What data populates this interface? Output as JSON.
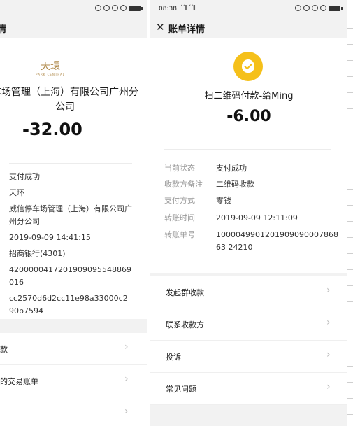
{
  "left": {
    "nav_title_fragment": "情",
    "brand_name": "天環",
    "brand_sub": "PARK CENTRAL",
    "merchant_name": "车场管理（上海）有限公司广州分公司",
    "amount": "-32.00",
    "info": [
      "支付成功",
      "天环",
      "威信停车场管理（上海）有限公司广州分公司",
      "2019-09-09 14:41:15",
      "招商银行(4301)",
      "4200000417201909095548869016",
      "cc2570d6d2cc11e98a33000c290b7594"
    ],
    "actions": [
      "款",
      "的交易账单",
      ""
    ]
  },
  "right": {
    "status_time": "08:38",
    "status_signal": "´´il ´´il",
    "nav_title": "账单详情",
    "pay_title": "扫二维码付款-给Ming",
    "amount": "-6.00",
    "details": [
      {
        "key": "当前状态",
        "value": "支付成功"
      },
      {
        "key": "收款方备注",
        "value": "二维码收款"
      },
      {
        "key": "支付方式",
        "value": "零钱"
      },
      {
        "key": "转账时间",
        "value": "2019-09-09 12:11:09"
      },
      {
        "key": "转账单号",
        "value": "100004990120190909000786863 24210"
      }
    ],
    "actions": [
      "发起群收款",
      "联系收款方",
      "投诉",
      "常见问题"
    ]
  },
  "icons": {
    "close": "close-icon",
    "chevron": "chevron-right-icon",
    "coin": "money-bag-icon"
  },
  "colors": {
    "coin": "#f5c01a",
    "brand": "#b08a4b",
    "background": "#f2f2f2"
  }
}
